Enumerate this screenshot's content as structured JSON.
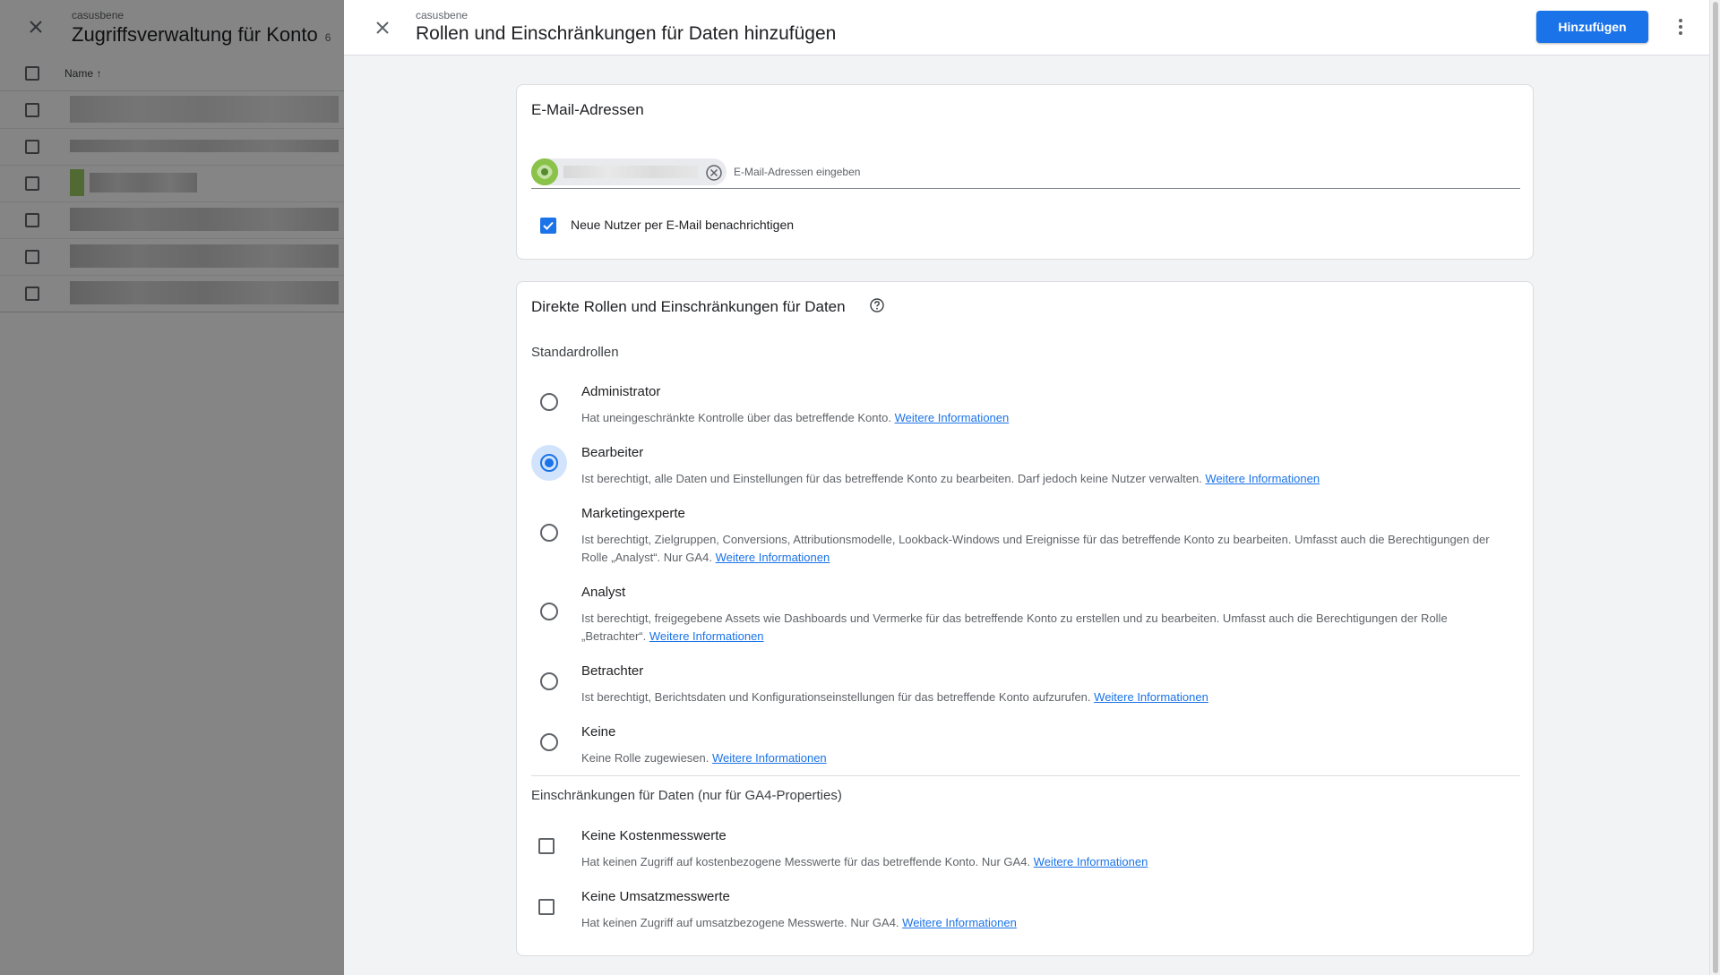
{
  "background": {
    "subtitle": "casusbene",
    "title": "Zugriffsverwaltung für Konto",
    "title_suffix": "6",
    "name_column": "Name"
  },
  "panel": {
    "subtitle": "casusbene",
    "title": "Rollen und Einschränkungen für Daten hinzufügen",
    "add_button": "Hinzufügen"
  },
  "email_card": {
    "title": "E-Mail-Adressen",
    "placeholder": "E-Mail-Adressen eingeben",
    "notify_label": "Neue Nutzer per E-Mail benachrichtigen",
    "notify_checked": true
  },
  "roles_card": {
    "title": "Direkte Rollen und Einschränkungen für Daten",
    "standard_roles_label": "Standardrollen",
    "selected_role": "Bearbeiter",
    "link_text": "Weitere Informationen",
    "roles": [
      {
        "title": "Administrator",
        "desc": "Hat uneingeschränkte Kontrolle über das betreffende Konto.",
        "link": "Weitere Informationen"
      },
      {
        "title": "Bearbeiter",
        "desc": "Ist berechtigt, alle Daten und Einstellungen für das betreffende Konto zu bearbeiten. Darf jedoch keine Nutzer verwalten.",
        "link": "Weitere Informationen"
      },
      {
        "title": "Marketingexperte",
        "desc": "Ist berechtigt, Zielgruppen, Conversions, Attributionsmodelle, Lookback-Windows und Ereignisse für das betreffende Konto zu bearbeiten. Umfasst auch die Berechtigungen der Rolle „Analyst“. Nur GA4.",
        "link": "Weitere Informationen"
      },
      {
        "title": "Analyst",
        "desc": "Ist berechtigt, freigegebene Assets wie Dashboards und Vermerke für das betreffende Konto zu erstellen und zu bearbeiten. Umfasst auch die Berechtigungen der Rolle „Betrachter“.",
        "link": "Weitere Informationen"
      },
      {
        "title": "Betrachter",
        "desc": "Ist berechtigt, Berichtsdaten und Konfigurationseinstellungen für das betreffende Konto aufzurufen.",
        "link": "Weitere Informationen"
      },
      {
        "title": "Keine",
        "desc": "Keine Rolle zugewiesen.",
        "link": "Weitere Informationen"
      }
    ],
    "restrictions_label": "Einschränkungen für Daten (nur für GA4-Properties)",
    "restrictions": [
      {
        "title": "Keine Kostenmesswerte",
        "desc": "Hat keinen Zugriff auf kostenbezogene Messwerte für das betreffende Konto. Nur GA4.",
        "link": "Weitere Informationen",
        "checked": false
      },
      {
        "title": "Keine Umsatzmesswerte",
        "desc": "Hat keinen Zugriff auf umsatzbezogene Messwerte. Nur GA4.",
        "link": "Weitere Informationen",
        "checked": false
      }
    ]
  },
  "colors": {
    "accent": "#1a73e8",
    "selected_radio_halo": "#d2e3fc",
    "panel_background": "#f1f3f4"
  }
}
